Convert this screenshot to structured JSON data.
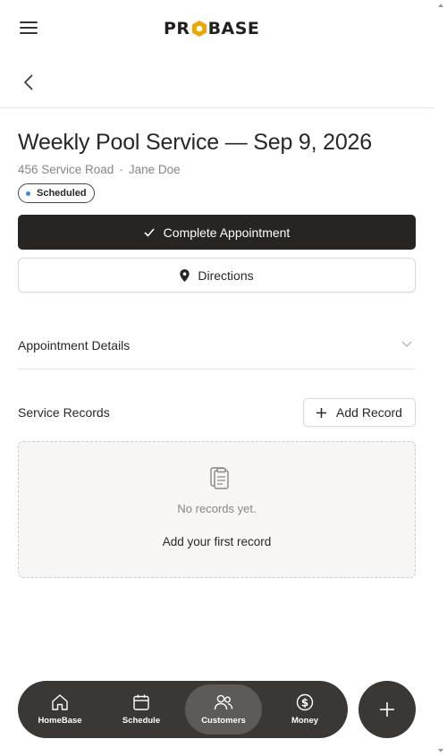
{
  "header": {
    "logo_left": "PR",
    "logo_right": "BASE",
    "menu_icon": "hamburger-icon",
    "back_icon": "chevron-left-icon"
  },
  "appointment": {
    "title": "Weekly Pool Service — Sep 9, 2026",
    "address": "456 Service Road",
    "separator": "·",
    "customer": "Jane Doe",
    "status": "Scheduled",
    "status_color": "#3b82f6"
  },
  "actions": {
    "complete_label": "Complete Appointment",
    "directions_label": "Directions"
  },
  "sections": {
    "details_label": "Appointment Details",
    "records_label": "Service Records",
    "add_record_label": "Add Record",
    "empty_message": "No records yet.",
    "empty_cta": "Add your first record"
  },
  "nav": {
    "items": [
      {
        "label": "HomeBase",
        "icon": "home-icon"
      },
      {
        "label": "Schedule",
        "icon": "calendar-icon"
      },
      {
        "label": "Customers",
        "icon": "users-icon",
        "active": true
      },
      {
        "label": "Money",
        "icon": "dollar-icon"
      }
    ],
    "fab_icon": "plus-icon"
  },
  "colors": {
    "primary": "#282422",
    "nav_bg": "#3a3735",
    "accent": "#f0a500"
  }
}
